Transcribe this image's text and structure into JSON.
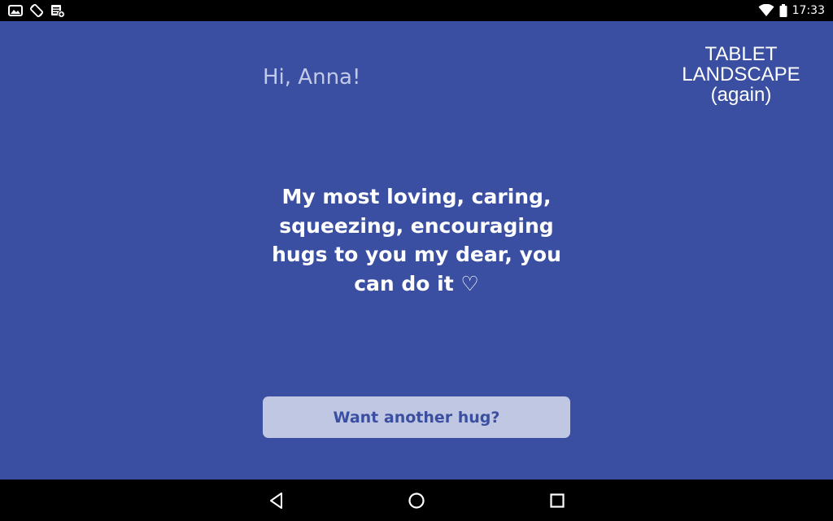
{
  "status_bar": {
    "left_icons": [
      "gallery-notification-icon",
      "screen-rotation-icon",
      "task-notification-icon"
    ],
    "right_icons": [
      "wifi-icon",
      "battery-icon"
    ],
    "time": "17:33"
  },
  "app": {
    "background_color": "#3a4fa1",
    "greeting": "Hi, Anna!",
    "orientation_label": "TABLET\nLANDSCAPE\n(again)",
    "message": "My most loving, caring, squeezing, encouraging hugs to you my dear, you can do it ♡",
    "button_label": "Want another hug?"
  },
  "nav_bar": {
    "buttons": [
      "back-icon",
      "home-icon",
      "recents-icon"
    ]
  }
}
